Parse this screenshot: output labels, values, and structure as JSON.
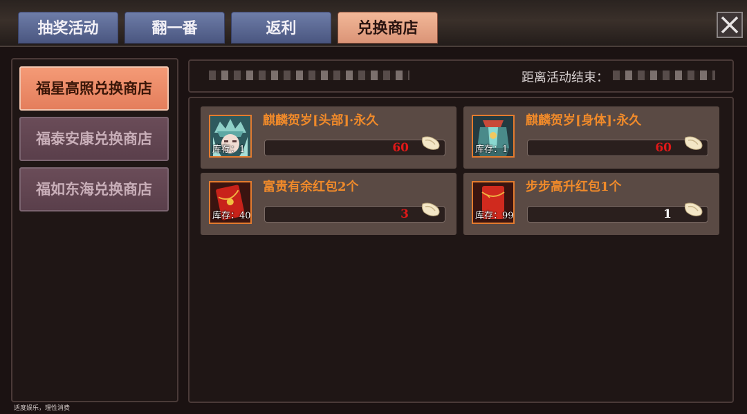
{
  "tabs": [
    {
      "label": "抽奖活动",
      "active": false
    },
    {
      "label": "翻一番",
      "active": false
    },
    {
      "label": "返利",
      "active": false
    },
    {
      "label": "兑换商店",
      "active": true
    }
  ],
  "shops": [
    {
      "label": "福星高照兑换商店",
      "active": true
    },
    {
      "label": "福泰安康兑换商店",
      "active": false
    },
    {
      "label": "福如东海兑换商店",
      "active": false
    }
  ],
  "info": {
    "timer_label": "距离活动结束："
  },
  "items": [
    {
      "name": "麒麟贺岁[头部]·永久",
      "stock": "库存：1",
      "price": "60",
      "price_color": "red",
      "icon": "dragon-helmet-icon"
    },
    {
      "name": "麒麟贺岁[身体]·永久",
      "stock": "库存：1",
      "price": "60",
      "price_color": "red",
      "icon": "dragon-armor-icon"
    },
    {
      "name": "富贵有余红包2个",
      "stock": "库存：40",
      "price": "3",
      "price_color": "red",
      "icon": "red-envelope-icon"
    },
    {
      "name": "步步高升红包1个",
      "stock": "库存：99+",
      "price": "1",
      "price_color": "white",
      "icon": "red-envelope-icon"
    }
  ],
  "footer": {
    "note": "适度娱乐，理性消费"
  },
  "colors": {
    "tab_active": "#db9477",
    "tab_inactive": "#5a6690",
    "shop_active": "#e47e5c",
    "item_name": "#f08a2a",
    "price_red": "#e01818"
  }
}
